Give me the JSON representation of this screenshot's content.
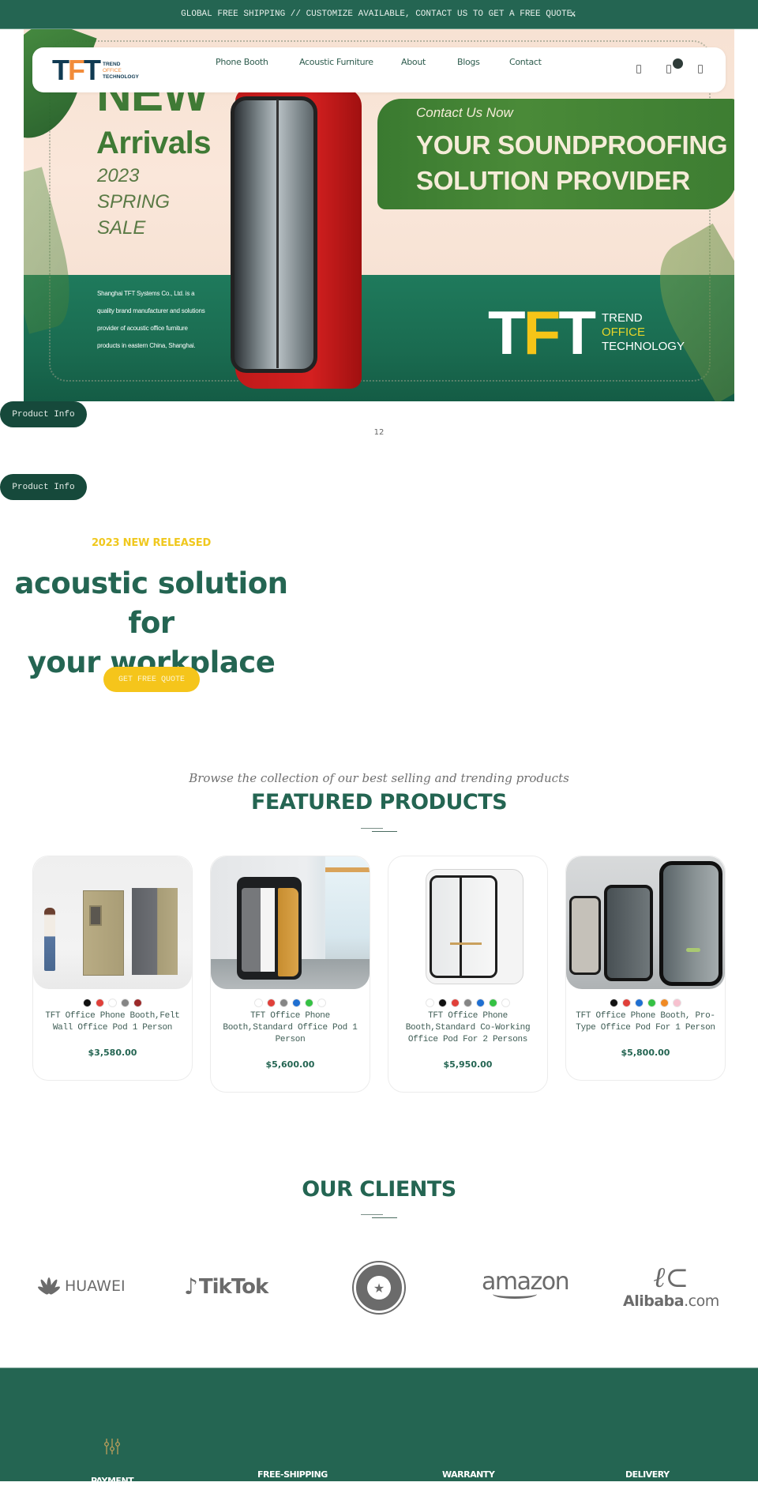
{
  "announcement": {
    "text": "GLOBAL FREE SHIPPING // CUSTOMIZE AVAILABLE, CONTACT US TO GET A FREE QUOTE.",
    "close_label": "x"
  },
  "header": {
    "logo": {
      "mark_t1": "T",
      "mark_f": "F",
      "mark_t2": "T",
      "line1": "TREND",
      "line2": "OFFICE",
      "line3": "TECHNOLOGY"
    },
    "nav": [
      {
        "label": "Phone Booth"
      },
      {
        "label": "Acoustic Furniture"
      },
      {
        "label": "About"
      },
      {
        "label": "Blogs"
      },
      {
        "label": "Contact"
      }
    ],
    "icons": [
      "search-icon",
      "cart-icon",
      "account-icon"
    ],
    "cart_badge_count": ""
  },
  "hero": {
    "new": "NEW",
    "arrivals": "Arrivals",
    "year": "2023",
    "season": "SPRING",
    "sale": "SALE",
    "contact_now": "Contact Us Now",
    "headline_line1": "YOUR SOUNDPROOFING",
    "headline_line2": "SOLUTION PROVIDER",
    "company_desc": "Shanghai TFT Systems Co., Ltd. is a quality brand manufacturer and solutions provider of acoustic office furniture products in eastern China, Shanghai.",
    "logo": {
      "t1": "T",
      "f": "F",
      "t2": "T",
      "line1": "TREND",
      "line2": "OFFICE",
      "line3": "TECHNOLOGY"
    },
    "colors": {
      "green": "#3f7a35",
      "brand_yellow": "#f5c518",
      "band_green": "#1a6b50"
    }
  },
  "product_info_buttons": [
    {
      "label": "Product Info"
    },
    {
      "label": "Product Info"
    }
  ],
  "slide_counter": "12",
  "promo": {
    "kicker": "2023 NEW RELEASED",
    "title_line1": "acoustic solution for",
    "title_line2": "your workplace",
    "cta": "GET FREE QUOTE"
  },
  "featured": {
    "subtitle": "Browse the collection of our best selling and trending products",
    "title": "FEATURED PRODUCTS",
    "products": [
      {
        "title": "TFT Office Phone Booth,Felt Wall Office Pod 1 Person",
        "price": "$3,580.00",
        "swatches": [
          "#111111",
          "#e0403a",
          "#ffffff",
          "#858585",
          "#9c2a2a"
        ]
      },
      {
        "title": "TFT Office Phone Booth,Standard Office Pod 1 Person",
        "price": "$5,600.00",
        "swatches": [
          "#ffffff",
          "#e0403a",
          "#858585",
          "#1f6fd1",
          "#35c144",
          "#ffffff"
        ]
      },
      {
        "title": "TFT Office Phone Booth,Standard Co-Working Office Pod For 2 Persons",
        "price": "$5,950.00",
        "swatches": [
          "#ffffff",
          "#111111",
          "#e0403a",
          "#858585",
          "#1f6fd1",
          "#35c144",
          "#ffffff"
        ]
      },
      {
        "title": "TFT Office Phone Booth, Pro-Type Office Pod For 1 Person",
        "price": "$5,800.00",
        "swatches": [
          "#111111",
          "#e0403a",
          "#1f6fd1",
          "#35c144",
          "#f08a24",
          "#f7c1cf"
        ]
      }
    ]
  },
  "clients": {
    "title": "OUR CLIENTS",
    "logos": [
      {
        "name": "HUAWEI"
      },
      {
        "name": "TikTok"
      },
      {
        "name": "STARBUCKS COFFEE"
      },
      {
        "name": "amazon"
      },
      {
        "name": "Alibaba",
        "suffix": ".com"
      }
    ]
  },
  "footer": {
    "features": [
      {
        "label": "PAYMENT",
        "icon": "sliders-icon"
      },
      {
        "label": "FREE-SHIPPING"
      },
      {
        "label": "WARRANTY"
      },
      {
        "label": "DELIVERY"
      }
    ],
    "colors": {
      "background": "#246552",
      "icon_gold": "#c9a45c"
    }
  }
}
